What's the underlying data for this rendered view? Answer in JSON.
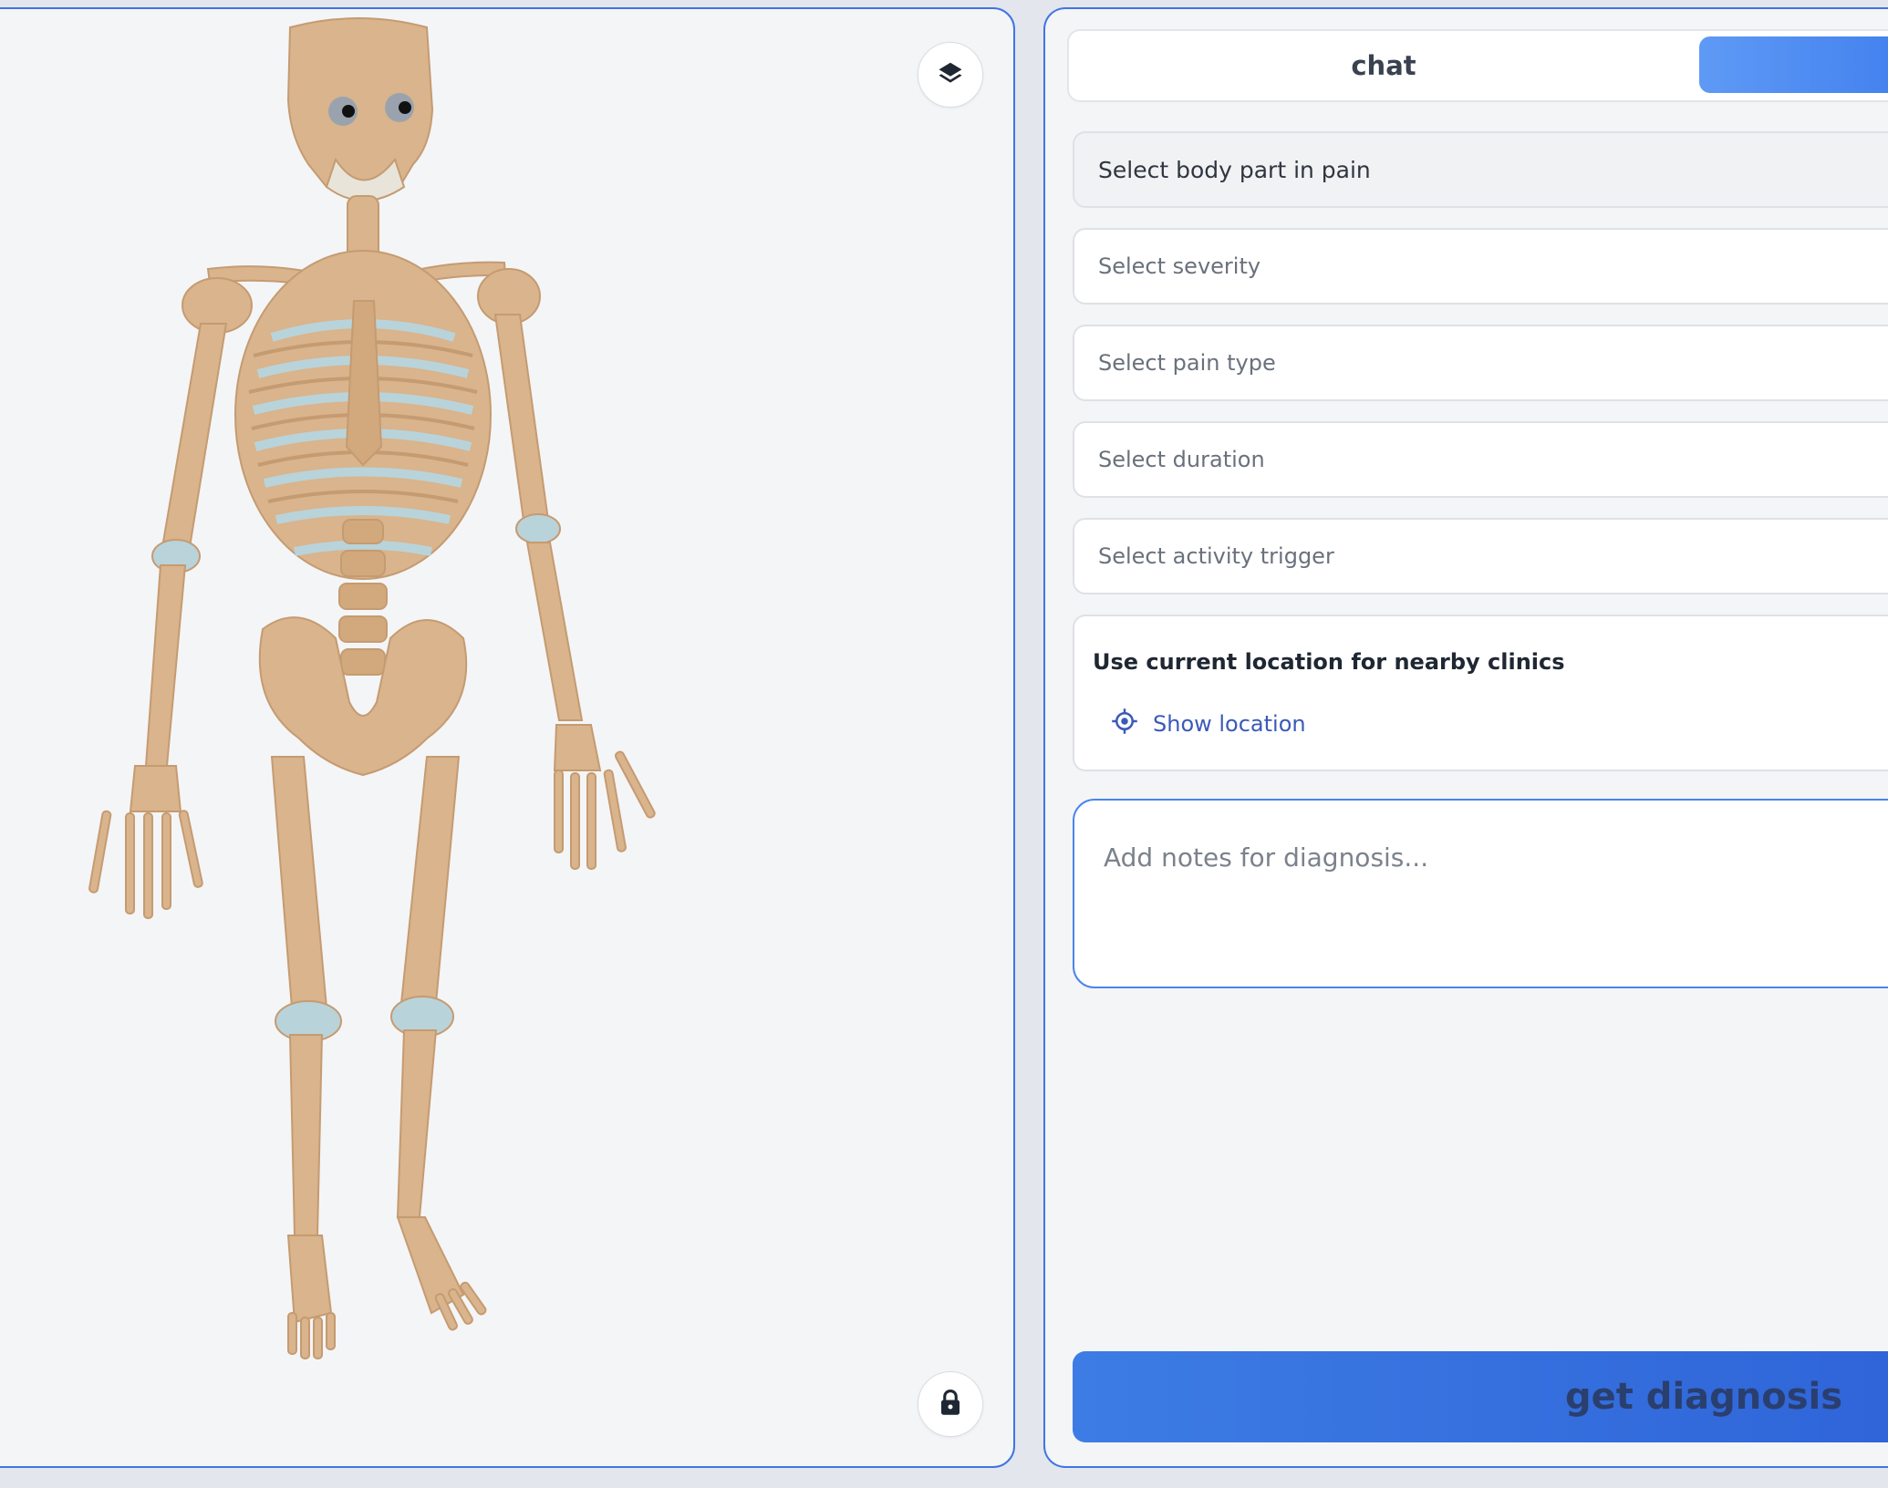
{
  "viewer": {
    "layers_icon": "layers-icon",
    "lock_icon": "lock-icon"
  },
  "panel": {
    "tabs": [
      {
        "label": "chat",
        "active": false
      },
      {
        "label": "",
        "active": true
      }
    ],
    "selects": [
      {
        "placeholder": "Select body part in pain"
      },
      {
        "placeholder": "Select severity"
      },
      {
        "placeholder": "Select pain type"
      },
      {
        "placeholder": "Select duration"
      },
      {
        "placeholder": "Select activity trigger"
      }
    ],
    "location": {
      "title": "Use current location for nearby clinics",
      "action_label": "Show location",
      "icon": "crosshair-icon"
    },
    "notes_placeholder": "Add notes for diagnosis...",
    "submit_label": "get diagnosis"
  },
  "colors": {
    "accent": "#3f74e6",
    "button": "#2e63d8",
    "bone": "#d9b48c",
    "cartilage": "#b9d3da"
  }
}
